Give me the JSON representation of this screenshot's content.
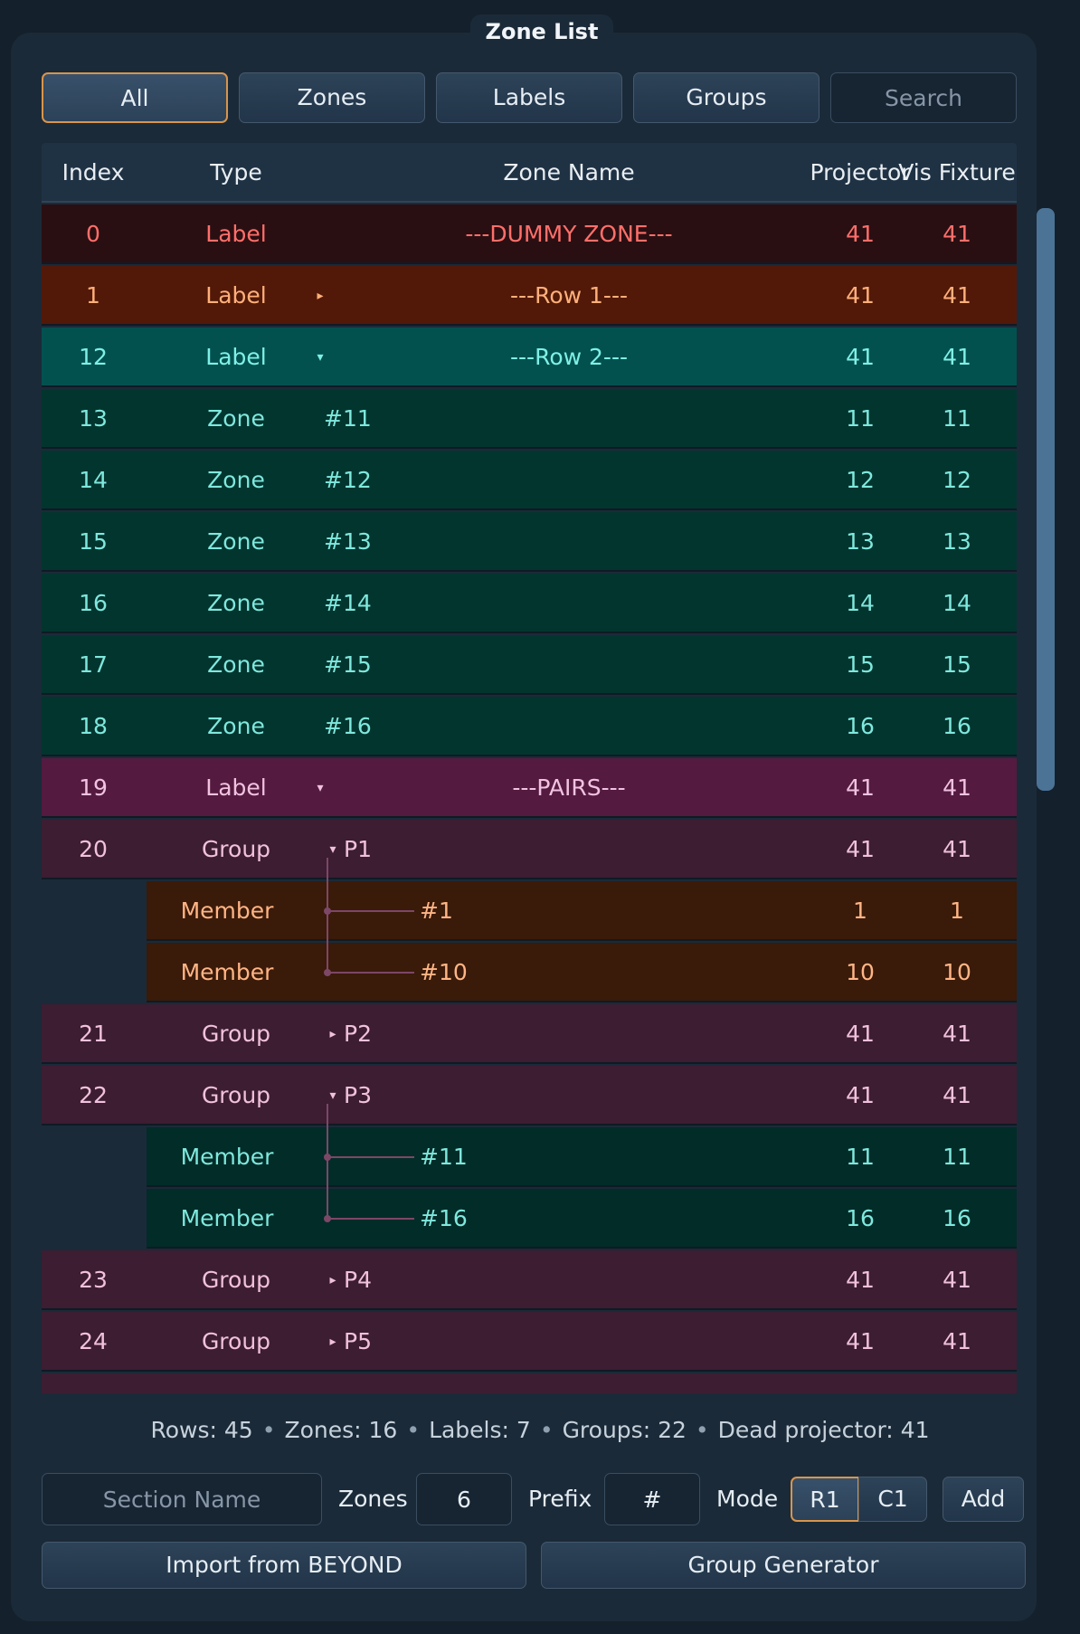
{
  "title": "Zone List",
  "filters": {
    "all": "All",
    "zones": "Zones",
    "labels": "Labels",
    "groups": "Groups",
    "search_placeholder": "Search"
  },
  "columns": {
    "index": "Index",
    "type": "Type",
    "zone_name": "Zone Name",
    "projector": "Projector",
    "vis_fixture": "Vis Fixture"
  },
  "rows": [
    {
      "index": "0",
      "type": "Label",
      "name": "---DUMMY ZONE---",
      "projector": "41",
      "vis": "41"
    },
    {
      "index": "1",
      "type": "Label",
      "arrow": "▸",
      "name": "---Row 1---",
      "projector": "41",
      "vis": "41"
    },
    {
      "index": "12",
      "type": "Label",
      "arrow": "▾",
      "name": "---Row 2---",
      "projector": "41",
      "vis": "41"
    },
    {
      "index": "13",
      "type": "Zone",
      "name": "#11",
      "projector": "11",
      "vis": "11"
    },
    {
      "index": "14",
      "type": "Zone",
      "name": "#12",
      "projector": "12",
      "vis": "12"
    },
    {
      "index": "15",
      "type": "Zone",
      "name": "#13",
      "projector": "13",
      "vis": "13"
    },
    {
      "index": "16",
      "type": "Zone",
      "name": "#14",
      "projector": "14",
      "vis": "14"
    },
    {
      "index": "17",
      "type": "Zone",
      "name": "#15",
      "projector": "15",
      "vis": "15"
    },
    {
      "index": "18",
      "type": "Zone",
      "name": "#16",
      "projector": "16",
      "vis": "16"
    },
    {
      "index": "19",
      "type": "Label",
      "arrow": "▾",
      "name": "---PAIRS---",
      "projector": "41",
      "vis": "41"
    },
    {
      "index": "20",
      "type": "Group",
      "arrow": "▾",
      "name": "P1",
      "projector": "41",
      "vis": "41"
    },
    {
      "type": "Member",
      "name": "#1",
      "projector": "1",
      "vis": "1"
    },
    {
      "type": "Member",
      "name": "#10",
      "projector": "10",
      "vis": "10"
    },
    {
      "index": "21",
      "type": "Group",
      "arrow": "▸",
      "name": "P2",
      "projector": "41",
      "vis": "41"
    },
    {
      "index": "22",
      "type": "Group",
      "arrow": "▾",
      "name": "P3",
      "projector": "41",
      "vis": "41"
    },
    {
      "type": "Member",
      "name": "#11",
      "projector": "11",
      "vis": "11"
    },
    {
      "type": "Member",
      "name": "#16",
      "projector": "16",
      "vis": "16"
    },
    {
      "index": "23",
      "type": "Group",
      "arrow": "▸",
      "name": "P4",
      "projector": "41",
      "vis": "41"
    },
    {
      "index": "24",
      "type": "Group",
      "arrow": "▸",
      "name": "P5",
      "projector": "41",
      "vis": "41"
    }
  ],
  "status": {
    "rows": "Rows: 45",
    "zones": "Zones: 16",
    "labels": "Labels: 7",
    "groups": "Groups: 22",
    "dead": "Dead projector: 41",
    "sep": "•"
  },
  "controls": {
    "section_placeholder": "Section Name",
    "zones_label": "Zones",
    "zones_value": "6",
    "prefix_label": "Prefix",
    "prefix_value": "#",
    "mode_label": "Mode",
    "mode_r1": "R1",
    "mode_c1": "C1",
    "add": "Add",
    "import": "Import from BEYOND",
    "group_generator": "Group Generator"
  },
  "colors": {
    "accent": "#d9954a",
    "background": "#14202b",
    "panel": "#1b2a38"
  }
}
